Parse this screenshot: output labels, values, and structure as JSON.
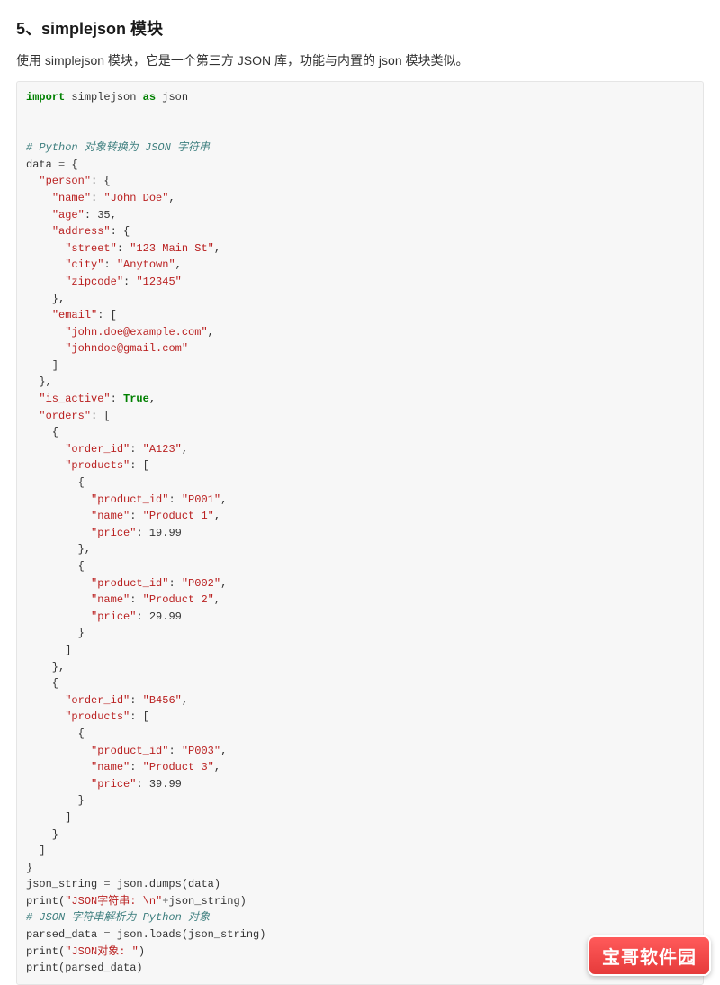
{
  "heading": "5、simplejson 模块",
  "description": "使用 simplejson 模块，它是一个第三方 JSON 库，功能与内置的 json 模块类似。",
  "watermark": "宝哥软件园",
  "code": {
    "tokens": [
      {
        "t": "kw",
        "v": "import"
      },
      {
        "t": "",
        "v": " simplejson "
      },
      {
        "t": "kw",
        "v": "as"
      },
      {
        "t": "",
        "v": " json\n"
      },
      {
        "t": "",
        "v": "\n\n"
      },
      {
        "t": "cmt",
        "v": "# Python 对象转换为 JSON 字符串"
      },
      {
        "t": "",
        "v": "\n"
      },
      {
        "t": "",
        "v": "data "
      },
      {
        "t": "op",
        "v": "="
      },
      {
        "t": "",
        "v": " {\n"
      },
      {
        "t": "",
        "v": "  "
      },
      {
        "t": "str",
        "v": "\"person\""
      },
      {
        "t": "",
        "v": ": {\n"
      },
      {
        "t": "",
        "v": "    "
      },
      {
        "t": "str",
        "v": "\"name\""
      },
      {
        "t": "",
        "v": ": "
      },
      {
        "t": "str",
        "v": "\"John Doe\""
      },
      {
        "t": "",
        "v": ",\n"
      },
      {
        "t": "",
        "v": "    "
      },
      {
        "t": "str",
        "v": "\"age\""
      },
      {
        "t": "",
        "v": ": "
      },
      {
        "t": "num",
        "v": "35"
      },
      {
        "t": "",
        "v": ",\n"
      },
      {
        "t": "",
        "v": "    "
      },
      {
        "t": "str",
        "v": "\"address\""
      },
      {
        "t": "",
        "v": ": {\n"
      },
      {
        "t": "",
        "v": "      "
      },
      {
        "t": "str",
        "v": "\"street\""
      },
      {
        "t": "",
        "v": ": "
      },
      {
        "t": "str",
        "v": "\"123 Main St\""
      },
      {
        "t": "",
        "v": ",\n"
      },
      {
        "t": "",
        "v": "      "
      },
      {
        "t": "str",
        "v": "\"city\""
      },
      {
        "t": "",
        "v": ": "
      },
      {
        "t": "str",
        "v": "\"Anytown\""
      },
      {
        "t": "",
        "v": ",\n"
      },
      {
        "t": "",
        "v": "      "
      },
      {
        "t": "str",
        "v": "\"zipcode\""
      },
      {
        "t": "",
        "v": ": "
      },
      {
        "t": "str",
        "v": "\"12345\""
      },
      {
        "t": "",
        "v": "\n"
      },
      {
        "t": "",
        "v": "    },\n"
      },
      {
        "t": "",
        "v": "    "
      },
      {
        "t": "str",
        "v": "\"email\""
      },
      {
        "t": "",
        "v": ": [\n"
      },
      {
        "t": "",
        "v": "      "
      },
      {
        "t": "str",
        "v": "\"john.doe@example.com\""
      },
      {
        "t": "",
        "v": ",\n"
      },
      {
        "t": "",
        "v": "      "
      },
      {
        "t": "str",
        "v": "\"johndoe@gmail.com\""
      },
      {
        "t": "",
        "v": "\n"
      },
      {
        "t": "",
        "v": "    ]\n"
      },
      {
        "t": "",
        "v": "  },\n"
      },
      {
        "t": "",
        "v": "  "
      },
      {
        "t": "str",
        "v": "\"is_active\""
      },
      {
        "t": "",
        "v": ": "
      },
      {
        "t": "bool",
        "v": "True"
      },
      {
        "t": "",
        "v": ",\n"
      },
      {
        "t": "",
        "v": "  "
      },
      {
        "t": "str",
        "v": "\"orders\""
      },
      {
        "t": "",
        "v": ": [\n"
      },
      {
        "t": "",
        "v": "    {\n"
      },
      {
        "t": "",
        "v": "      "
      },
      {
        "t": "str",
        "v": "\"order_id\""
      },
      {
        "t": "",
        "v": ": "
      },
      {
        "t": "str",
        "v": "\"A123\""
      },
      {
        "t": "",
        "v": ",\n"
      },
      {
        "t": "",
        "v": "      "
      },
      {
        "t": "str",
        "v": "\"products\""
      },
      {
        "t": "",
        "v": ": [\n"
      },
      {
        "t": "",
        "v": "        {\n"
      },
      {
        "t": "",
        "v": "          "
      },
      {
        "t": "str",
        "v": "\"product_id\""
      },
      {
        "t": "",
        "v": ": "
      },
      {
        "t": "str",
        "v": "\"P001\""
      },
      {
        "t": "",
        "v": ",\n"
      },
      {
        "t": "",
        "v": "          "
      },
      {
        "t": "str",
        "v": "\"name\""
      },
      {
        "t": "",
        "v": ": "
      },
      {
        "t": "str",
        "v": "\"Product 1\""
      },
      {
        "t": "",
        "v": ",\n"
      },
      {
        "t": "",
        "v": "          "
      },
      {
        "t": "str",
        "v": "\"price\""
      },
      {
        "t": "",
        "v": ": "
      },
      {
        "t": "num",
        "v": "19.99"
      },
      {
        "t": "",
        "v": "\n"
      },
      {
        "t": "",
        "v": "        },\n"
      },
      {
        "t": "",
        "v": "        {\n"
      },
      {
        "t": "",
        "v": "          "
      },
      {
        "t": "str",
        "v": "\"product_id\""
      },
      {
        "t": "",
        "v": ": "
      },
      {
        "t": "str",
        "v": "\"P002\""
      },
      {
        "t": "",
        "v": ",\n"
      },
      {
        "t": "",
        "v": "          "
      },
      {
        "t": "str",
        "v": "\"name\""
      },
      {
        "t": "",
        "v": ": "
      },
      {
        "t": "str",
        "v": "\"Product 2\""
      },
      {
        "t": "",
        "v": ",\n"
      },
      {
        "t": "",
        "v": "          "
      },
      {
        "t": "str",
        "v": "\"price\""
      },
      {
        "t": "",
        "v": ": "
      },
      {
        "t": "num",
        "v": "29.99"
      },
      {
        "t": "",
        "v": "\n"
      },
      {
        "t": "",
        "v": "        }\n"
      },
      {
        "t": "",
        "v": "      ]\n"
      },
      {
        "t": "",
        "v": "    },\n"
      },
      {
        "t": "",
        "v": "    {\n"
      },
      {
        "t": "",
        "v": "      "
      },
      {
        "t": "str",
        "v": "\"order_id\""
      },
      {
        "t": "",
        "v": ": "
      },
      {
        "t": "str",
        "v": "\"B456\""
      },
      {
        "t": "",
        "v": ",\n"
      },
      {
        "t": "",
        "v": "      "
      },
      {
        "t": "str",
        "v": "\"products\""
      },
      {
        "t": "",
        "v": ": [\n"
      },
      {
        "t": "",
        "v": "        {\n"
      },
      {
        "t": "",
        "v": "          "
      },
      {
        "t": "str",
        "v": "\"product_id\""
      },
      {
        "t": "",
        "v": ": "
      },
      {
        "t": "str",
        "v": "\"P003\""
      },
      {
        "t": "",
        "v": ",\n"
      },
      {
        "t": "",
        "v": "          "
      },
      {
        "t": "str",
        "v": "\"name\""
      },
      {
        "t": "",
        "v": ": "
      },
      {
        "t": "str",
        "v": "\"Product 3\""
      },
      {
        "t": "",
        "v": ",\n"
      },
      {
        "t": "",
        "v": "          "
      },
      {
        "t": "str",
        "v": "\"price\""
      },
      {
        "t": "",
        "v": ": "
      },
      {
        "t": "num",
        "v": "39.99"
      },
      {
        "t": "",
        "v": "\n"
      },
      {
        "t": "",
        "v": "        }\n"
      },
      {
        "t": "",
        "v": "      ]\n"
      },
      {
        "t": "",
        "v": "    }\n"
      },
      {
        "t": "",
        "v": "  ]\n"
      },
      {
        "t": "",
        "v": "}\n"
      },
      {
        "t": "",
        "v": "json_string "
      },
      {
        "t": "op",
        "v": "="
      },
      {
        "t": "",
        "v": " json.dumps(data)\n"
      },
      {
        "t": "",
        "v": "print("
      },
      {
        "t": "str",
        "v": "\"JSON字符串: \\n\""
      },
      {
        "t": "op",
        "v": "+"
      },
      {
        "t": "",
        "v": "json_string)\n"
      },
      {
        "t": "cmt",
        "v": "# JSON 字符串解析为 Python 对象"
      },
      {
        "t": "",
        "v": "\n"
      },
      {
        "t": "",
        "v": "parsed_data "
      },
      {
        "t": "op",
        "v": "="
      },
      {
        "t": "",
        "v": " json.loads(json_string)\n"
      },
      {
        "t": "",
        "v": "print("
      },
      {
        "t": "str",
        "v": "\"JSON对象: \""
      },
      {
        "t": "",
        "v": ")\n"
      },
      {
        "t": "",
        "v": "print(parsed_data)"
      }
    ]
  }
}
